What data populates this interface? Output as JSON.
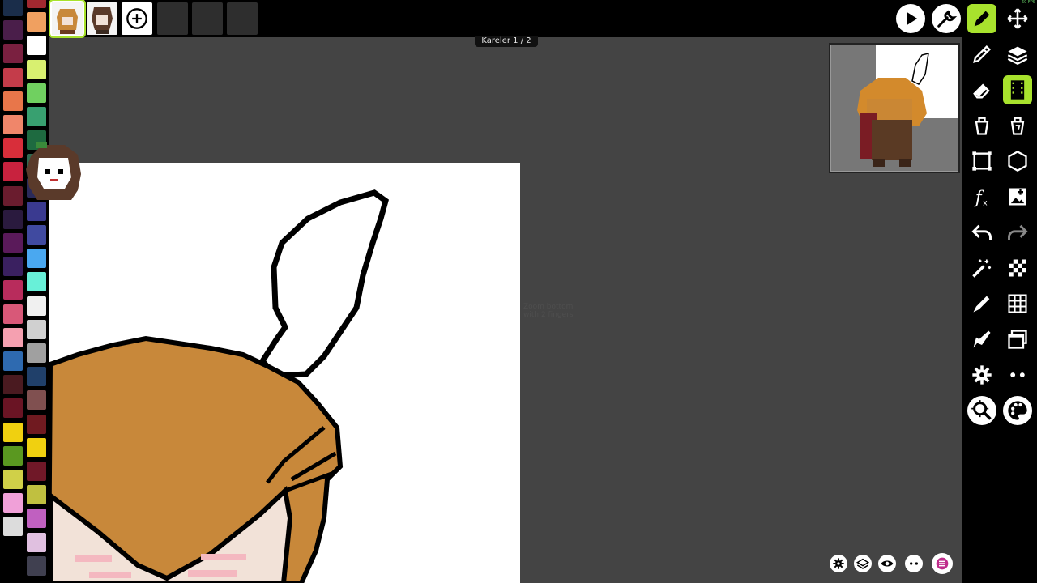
{
  "frame_label": "Kareler 1 / 2",
  "ghost_hint": "Zoom bottom with 2 fingers",
  "fps_text": "60 FPS",
  "palette": {
    "col1": [
      "#1a2d4a",
      "#4a1e4a",
      "#7a2040",
      "#c43c4a",
      "#e8764a",
      "#f0866a",
      "#d82e3a",
      "#c8223e",
      "#6a1c2e",
      "#2a1a3e",
      "#5a1a5a",
      "#3a2060",
      "#b82c5c",
      "#d85878",
      "#f5a0b0",
      "#2e6ab0",
      "#4a1a20",
      "#6a1424",
      "#f0d010",
      "#5a9820",
      "#d0d048",
      "#f0a0d8",
      "#dcdcdc"
    ],
    "col2": [
      "#a02830",
      "#f0a060",
      "#ffffff",
      "#d8f070",
      "#70d060",
      "#38a070",
      "#1e6a40",
      "#2e6a50",
      "#2a2a5a",
      "#3a3a90",
      "#404aa0",
      "#4aa8f0",
      "#68f0d8",
      "#f0f0f0",
      "#d0d0d0",
      "#a0a0a0",
      "#20406a",
      "#805050",
      "#701a20",
      "#f0d010",
      "#701828",
      "#c0c040",
      "#c060c0",
      "#e0c0e0",
      "#404050"
    ]
  },
  "frames": [
    {
      "name": "frame-1-thumbnail"
    },
    {
      "name": "frame-2-thumbnail"
    }
  ],
  "toolbar": {
    "play": "play-icon",
    "settings_wrench": "wrench-icon",
    "pencil": "pencil-icon",
    "move": "move-icon",
    "eyedropper": "eyedropper-icon",
    "layers": "layers-icon",
    "eraser": "eraser-icon",
    "animation": "film-icon",
    "fill": "paint-bucket-icon",
    "fill_replace": "bucket-replace-icon",
    "select_rect": "select-rect-icon",
    "shape": "hexagon-icon",
    "effects": "function-icon",
    "import": "import-image-icon",
    "undo": "undo-icon",
    "redo": "redo-icon",
    "magic_wand": "magic-wand-icon",
    "grid_checker": "checker-icon",
    "brush": "brush-icon",
    "grid": "grid-icon",
    "brush2": "brush-icon",
    "windows": "windows-icon",
    "gear": "gear-icon",
    "more": "more-icon",
    "zoom": "zoom-icon",
    "palette": "palette-icon"
  },
  "colors": {
    "accent": "#a8e22d",
    "background": "#444444",
    "hair": "#c8883a",
    "skin": "#f2e2d8",
    "blush": "#f4b8c0"
  }
}
